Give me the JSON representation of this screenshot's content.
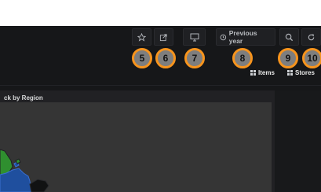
{
  "toolbar": {
    "star_icon": "star-icon",
    "share_icon": "share-icon",
    "tv_icon": "monitor-icon",
    "timepicker": {
      "icon": "clock-icon",
      "label": "Previous year"
    },
    "zoom_icon": "zoom-out-icon",
    "refresh_icon": "refresh-icon"
  },
  "markers": [
    "5",
    "6",
    "7",
    "8",
    "9",
    "10"
  ],
  "links": [
    {
      "icon": "grid-icon",
      "label": "Items"
    },
    {
      "icon": "grid-icon",
      "label": "Stores"
    }
  ],
  "panel": {
    "title": "ck by Region"
  },
  "colors": {
    "background": "#161719",
    "marker_fill": "#7e7e7e",
    "marker_border": "#f7941d",
    "map_green": "#2f8f2f",
    "map_blue": "#1f4f9e"
  }
}
